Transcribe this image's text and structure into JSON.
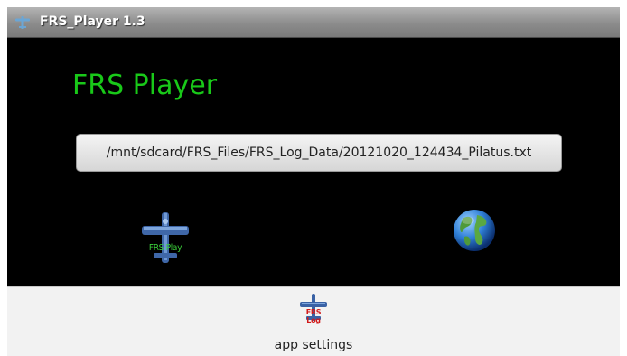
{
  "titlebar": {
    "title": "FRS_Player 1.3",
    "icon": "airplane-icon"
  },
  "main": {
    "heading": "FRS Player",
    "heading_color": "#19c919",
    "file_path": "/mnt/sdcard/FRS_Files/FRS_Log_Data/20121020_124434_Pilatus.txt",
    "play_button_label": "FRS Play",
    "play_button_icon": "airplane-play-icon",
    "globe_button_icon": "globe-icon"
  },
  "settings": {
    "label": "app settings",
    "icon_label": "FRS Log",
    "icon": "airplane-log-icon"
  }
}
